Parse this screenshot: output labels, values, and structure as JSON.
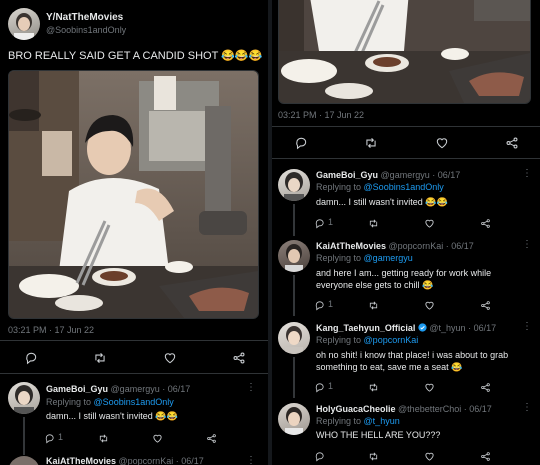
{
  "main_tweet": {
    "display_name": "Y/NatTheMovies",
    "handle": "@Soobins1andOnly",
    "text": "BRO REALLY SAID GET A CANDID SHOT 😂😂😂",
    "timestamp": "03:21 PM · 17 Jun 22"
  },
  "right_top": {
    "timestamp": "03:21 PM · 17 Jun 22"
  },
  "replies_left": [
    {
      "name": "GameBoi_Gyu",
      "handle": "@gamergyu",
      "date": "· 06/17",
      "replying_to": "Replying to",
      "reply_handle": "@Soobins1andOnly",
      "text": "damn... I still wasn't invited 😂😂",
      "likes": "1"
    },
    {
      "name": "KaiAtTheMovies",
      "handle": "@popcornKai",
      "date": "· 06/17"
    }
  ],
  "replies_right": [
    {
      "name": "GameBoi_Gyu",
      "handle": "@gamergyu",
      "date": "· 06/17",
      "replying_to": "Replying to",
      "reply_handle": "@Soobins1andOnly",
      "text": "damn... I still wasn't invited 😂😂",
      "likes": "1"
    },
    {
      "name": "KaiAtTheMovies",
      "handle": "@popcornKai",
      "date": "· 06/17",
      "replying_to": "Replying to",
      "reply_handle": "@gamergyu",
      "text_line1": "and here I am... getting ready for work while",
      "text_line2": "everyone else gets to chill 😂",
      "likes": "1"
    },
    {
      "name": "Kang_Taehyun_Official",
      "handle": "@t_hyun",
      "date": "· 06/17",
      "replying_to": "Replying to",
      "reply_handle": "@popcornKai",
      "text_line1": "oh no shit! i know that place! i was about to grab",
      "text_line2": "something to eat, save me a seat 😂",
      "likes": "1"
    },
    {
      "name": "HolyGuacaCheolie",
      "handle": "@thebetterChoi",
      "date": "· 06/17",
      "replying_to": "Replying to",
      "reply_handle": "@t_hyun",
      "text": "WHO THE HELL ARE YOU???"
    }
  ],
  "icons": [
    "reply-icon",
    "retweet-icon",
    "like-icon",
    "share-icon",
    "more-icon",
    "verified-icon"
  ],
  "colors": {
    "background": "#000000",
    "link": "#1d9bf0",
    "muted": "#71767b",
    "divider": "#2f3336"
  }
}
